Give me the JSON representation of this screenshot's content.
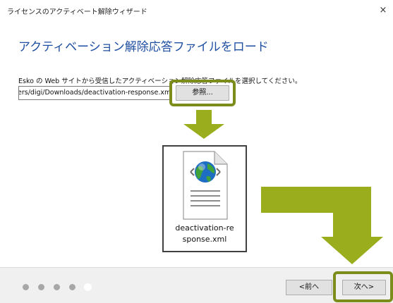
{
  "window": {
    "title": "ライセンスのアクティベート解除ウィザード",
    "close_glyph": "×"
  },
  "page": {
    "heading": "アクティベーション解除応答ファイルをロード",
    "instruction": "Esko の Web サイトから受信したアクティベーション解除応答ファイルを選択してください。",
    "file_path": "ers/digi/Downloads/deactivation-response.xml",
    "browse_label": "参照..."
  },
  "file_icon": {
    "name_line1": "deactivation-re",
    "name_line2": "sponse.xml"
  },
  "footer": {
    "prev_label": "<前へ",
    "next_label": "次へ>",
    "steps_total": 5,
    "step_current": 5
  },
  "colors": {
    "heading": "#1f4fa1",
    "highlight": "#7d8d1c",
    "arrow": "#9aad1d"
  }
}
